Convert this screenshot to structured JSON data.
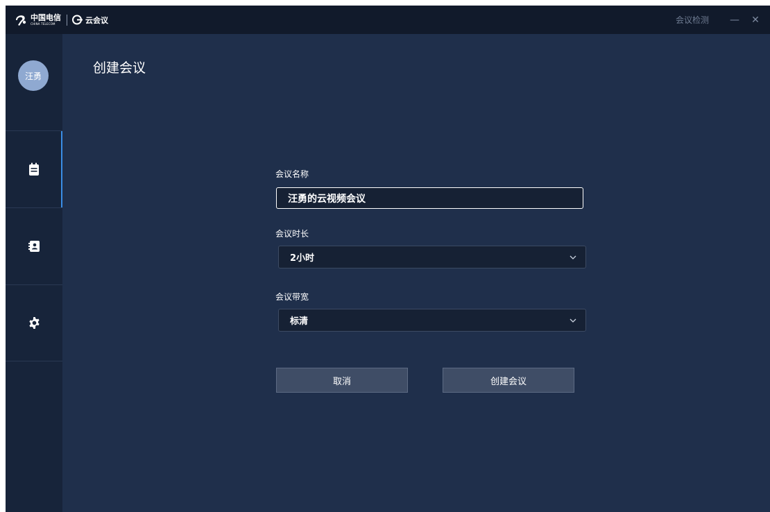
{
  "titlebar": {
    "brand_cn": "中国电信",
    "brand_en": "CHINA TELECOM",
    "app_name": "云会议",
    "check_label": "会议检测",
    "minimize": "—",
    "close": "✕"
  },
  "sidebar": {
    "avatar_text": "汪勇",
    "items": [
      {
        "icon": "calendar-icon",
        "active": true
      },
      {
        "icon": "contacts-icon",
        "active": false
      },
      {
        "icon": "gear-icon",
        "active": false
      }
    ],
    "accent_color": "#3a8ee6"
  },
  "main": {
    "title": "创建会议",
    "name_label": "会议名称",
    "name_value": "汪勇的云视频会议",
    "duration_label": "会议时长",
    "duration_value": "2小时",
    "bandwidth_label": "会议带宽",
    "bandwidth_value": "标清",
    "cancel_label": "取消",
    "create_label": "创建会议"
  }
}
